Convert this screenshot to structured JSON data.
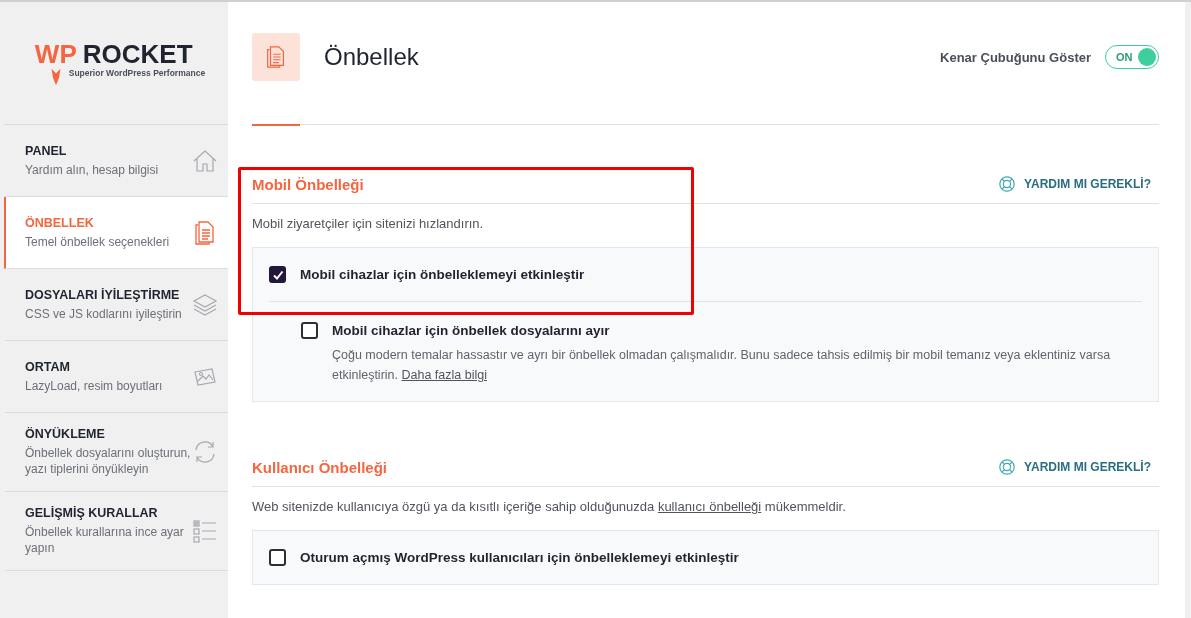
{
  "logo": {
    "brand_first": "WP",
    "brand_second": "ROCKET",
    "tagline": "Superior WordPress Performance"
  },
  "sidebar": {
    "items": [
      {
        "title": "PANEL",
        "subtitle": "Yardım alın, hesap bilgisi",
        "selected": false
      },
      {
        "title": "ÖNBELLEK",
        "subtitle": "Temel önbellek seçenekleri",
        "selected": true
      },
      {
        "title": "DOSYALARI İYİLEŞTİRME",
        "subtitle": "CSS ve JS kodlarını iyileştirin",
        "selected": false
      },
      {
        "title": "ORTAM",
        "subtitle": "LazyLoad, resim boyutları",
        "selected": false
      },
      {
        "title": "ÖNYÜKLEME",
        "subtitle": "Önbellek dosyalarını oluşturun, yazı tiplerini önyükleyin",
        "selected": false
      },
      {
        "title": "GELİŞMİŞ KURALLAR",
        "subtitle": "Önbellek kurallarına ince ayar yapın",
        "selected": false
      }
    ]
  },
  "header": {
    "title": "Önbellek",
    "sidebar_toggle": {
      "label": "Kenar Çubuğunu Göster",
      "state_text": "ON",
      "on": true
    }
  },
  "sections": [
    {
      "title": "Mobil Önbelleği",
      "help": "YARDIM MI GEREKLİ?",
      "annotated": true,
      "description": {
        "before": "Mobil ziyaretçiler için sitenizi hızlandırın."
      },
      "options": [
        {
          "label": "Mobil cihazlar için önbelleklemeyi etkinleştir",
          "checked": true,
          "sub_options": [
            {
              "label": "Mobil cihazlar için önbellek dosyalarını ayır",
              "checked": false,
              "hint": {
                "before": "Çoğu modern temalar hassastır ve ayrı bir önbellek olmadan çalışmalıdır. Bunu sadece tahsis edilmiş bir mobil temanız veya eklentiniz varsa etkinleştirin. ",
                "link": "Daha fazla bilgi"
              }
            }
          ]
        }
      ]
    },
    {
      "title": "Kullanıcı Önbelleği",
      "help": "YARDIM MI GEREKLİ?",
      "annotated": false,
      "description": {
        "before": "Web sitenizde kullanıcıya özgü ya da kısıtlı içeriğe sahip olduğunuzda ",
        "link": "kullanıcı önbelleği",
        "after": " mükemmeldir."
      },
      "options": [
        {
          "label": "Oturum açmış WordPress kullanıcıları için önbelleklemeyi etkinleştir",
          "checked": false
        }
      ]
    }
  ]
}
